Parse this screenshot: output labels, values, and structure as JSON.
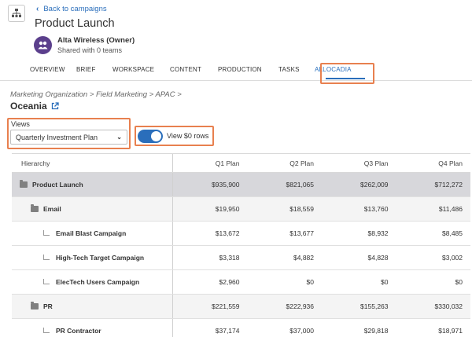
{
  "header": {
    "back_label": "Back to campaigns",
    "title": "Product Launch",
    "owner": "Alta Wireless (Owner)",
    "shared": "Shared with 0 teams"
  },
  "tabs": [
    "OVERVIEW",
    "BRIEF",
    "WORKSPACE",
    "CONTENT",
    "PRODUCTION",
    "TASKS",
    "ALLOCADIA"
  ],
  "active_tab": "ALLOCADIA",
  "breadcrumb": "Marketing Organization > Field Marketing > APAC >",
  "region": "Oceania",
  "views": {
    "label": "Views",
    "selected": "Quarterly Investment Plan"
  },
  "toggle": {
    "label": "View $0 rows",
    "on": true
  },
  "table": {
    "columns": [
      "Hierarchy",
      "Q1 Plan",
      "Q2 Plan",
      "Q3 Plan",
      "Q4 Plan"
    ],
    "rows": [
      {
        "name": "Product Launch",
        "level": 0,
        "values": [
          "$935,900",
          "$821,065",
          "$262,009",
          "$712,272"
        ]
      },
      {
        "name": "Email",
        "level": 1,
        "values": [
          "$19,950",
          "$18,559",
          "$13,760",
          "$11,486"
        ]
      },
      {
        "name": "Email Blast Campaign",
        "level": 2,
        "values": [
          "$13,672",
          "$13,677",
          "$8,932",
          "$8,485"
        ]
      },
      {
        "name": "High-Tech Target Campaign",
        "level": 2,
        "values": [
          "$3,318",
          "$4,882",
          "$4,828",
          "$3,002"
        ]
      },
      {
        "name": "ElecTech Users Campaign",
        "level": 2,
        "values": [
          "$2,960",
          "$0",
          "$0",
          "$0"
        ]
      },
      {
        "name": "PR",
        "level": 1,
        "values": [
          "$221,559",
          "$222,936",
          "$155,263",
          "$330,032"
        ]
      },
      {
        "name": "PR Contractor",
        "level": 2,
        "values": [
          "$37,174",
          "$37,000",
          "$29,818",
          "$18,971"
        ]
      }
    ]
  },
  "colors": {
    "accent": "#2a6ebb",
    "highlight": "#e8804f",
    "avatar": "#5b3f8c"
  }
}
